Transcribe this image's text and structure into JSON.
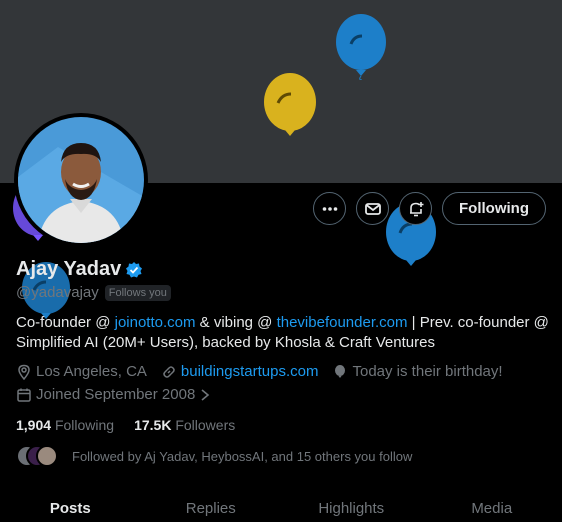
{
  "profile": {
    "name": "Ajay Yadav",
    "handle": "@yadavajay",
    "follows_you": "Follows you",
    "bio": {
      "t1": "Co-founder @ ",
      "link1": "joinotto.com",
      "t2": " & vibing @ ",
      "link2": "thevibefounder.com",
      "t3": " | Prev. co-founder @ Simplified AI (20M+ Users), backed by Khosla & Craft Ventures"
    },
    "location": "Los Angeles, CA",
    "website": "buildingstartups.com",
    "birthday": "Today is their birthday!",
    "joined": "Joined September 2008",
    "following_count": "1,904",
    "following_label": "Following",
    "followers_count": "17.5K",
    "followers_label": "Followers",
    "followed_by": "Followed by Aj Yadav, HeybossAI, and 15 others you follow"
  },
  "actions": {
    "follow_label": "Following"
  },
  "tabs": [
    {
      "label": "Posts",
      "active": true
    },
    {
      "label": "Replies"
    },
    {
      "label": "Highlights"
    },
    {
      "label": "Media"
    }
  ],
  "colors": {
    "banner": "#333639",
    "accent": "#1d9bf0",
    "balloon_blue": "#1d7fc9",
    "balloon_yellow": "#d9b21e",
    "balloon_purple": "#7856ff"
  }
}
